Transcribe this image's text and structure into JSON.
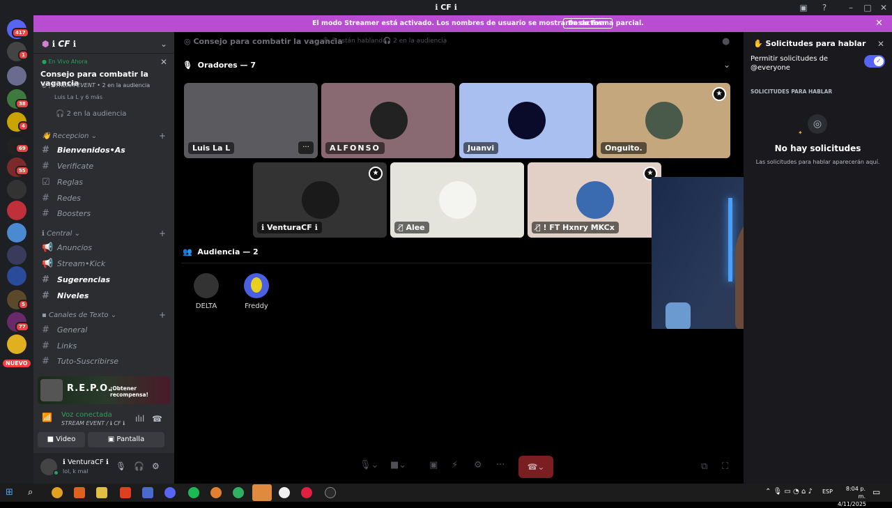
{
  "window": {
    "title": "ℹ︎ CF ℹ︎"
  },
  "rail": {
    "badges": [
      "417",
      "1",
      "38",
      "4",
      "69",
      "55",
      "5",
      "77"
    ],
    "nuevo": "NUEVO"
  },
  "banner": {
    "text": "El modo Streamer está activado. Los nombres de usuario se mostrarán de forma parcial.",
    "button": "Desactivar"
  },
  "sidebar": {
    "server_name": "ℹ︎ CF ℹ︎",
    "live_label": "En Vivo Ahora",
    "stage_title": "Consejo para combatir la vagancia",
    "event_line": "STREAM EVENT",
    "event_audience": "2 en la audiencia",
    "event_users": "Luis La L y 6 más",
    "audience_row": "2 en la audiencia",
    "categories": {
      "recepcion": "Recepcion",
      "central": "Central",
      "canales": "Canales de Texto"
    },
    "channels": [
      {
        "icon": "#",
        "label": "Bienvenidos•As",
        "bold": true
      },
      {
        "icon": "#",
        "label": "Verificate",
        "bold": false
      },
      {
        "icon": "#",
        "label": "Reglas",
        "bold": false
      },
      {
        "icon": "#",
        "label": "Redes",
        "bold": false
      },
      {
        "icon": "#",
        "label": "Boosters",
        "bold": false
      },
      {
        "icon": "◄",
        "label": "Anuncios",
        "bold": false
      },
      {
        "icon": "◄",
        "label": "Stream•Kick",
        "bold": false
      },
      {
        "icon": "#",
        "label": "Sugerencias",
        "bold": true
      },
      {
        "icon": "#",
        "label": "Niveles",
        "bold": true
      },
      {
        "icon": "#",
        "label": "General",
        "bold": false
      },
      {
        "icon": "#",
        "label": "Links",
        "bold": false
      },
      {
        "icon": "#",
        "label": "Tuto-Suscribirse",
        "bold": false
      }
    ],
    "promo_title": "R.E.P.O.",
    "promo_button": "¡Obtener recompensa!",
    "voice_status": "Voz conectada",
    "voice_channel": "STREAM EVENT / ℹ︎ CF ℹ︎",
    "video_label": "Video",
    "screen_label": "Pantalla",
    "user_name": "VenturaCF",
    "user_status": "lol, k mal"
  },
  "main": {
    "header_title": "Consejo para combatir la vagancia",
    "speaking": "7 están hablando",
    "audience_count": "2 en la audiencia",
    "speakers_heading": "Oradores — 7",
    "speakers": [
      {
        "name": "Luis La L",
        "bg": "#5a5a5f"
      },
      {
        "name": "ALFONSO",
        "bg": "#8a6a72"
      },
      {
        "name": "Juanvi",
        "bg": "#a9bff0"
      },
      {
        "name": "Onguito.",
        "bg": "#c4a77d"
      },
      {
        "name": "VenturaCF",
        "bg": "#333333"
      },
      {
        "name": "Alee",
        "bg": "#e4e4dc"
      },
      {
        "name": "! FT Hxnry MKCx",
        "bg": "#e2d0c6"
      }
    ],
    "audience_heading": "Audiencia — 2",
    "audience": [
      {
        "name": "DELTA"
      },
      {
        "name": "Freddy"
      }
    ]
  },
  "rpanel": {
    "title": "Solicitudes para hablar",
    "permit_label": "Permitir solicitudes de @everyone",
    "section": "SOLICITUDES PARA HABLAR",
    "empty_title": "No hay solicitudes",
    "empty_sub": "Las solicitudes para hablar aparecerán aquí."
  },
  "taskbar": {
    "lang": "ESP",
    "time": "8:04 p. m.",
    "date": "4/11/2025"
  },
  "colors": {
    "accent": "#5865f2",
    "banner": "#b94dd1",
    "danger": "#da373c",
    "online": "#23a55a"
  }
}
